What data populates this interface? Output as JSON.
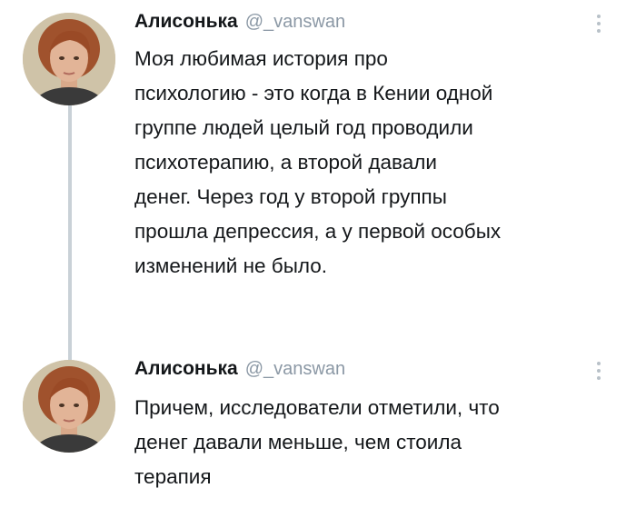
{
  "thread": {
    "line_color": "#c9d1d7",
    "tweets": [
      {
        "display_name": "Алисонька",
        "handle": "@_vanswan",
        "avatar_icon": "profile-photo-avatar",
        "more_icon": "vertical-ellipsis-icon",
        "text": "Моя любимая история про\nпсихологию - это когда в Кении одной\nгруппе людей целый год проводили\nпсихотерапию, а второй давали\nденег. Через год у второй группы\nпрошла депрессия, а у первой особых\nизменений не было."
      },
      {
        "display_name": "Алисонька",
        "handle": "@_vanswan",
        "avatar_icon": "profile-photo-avatar",
        "more_icon": "vertical-ellipsis-icon",
        "text": "Причем, исследователи отметили, что\nденег давали меньше, чем стоила\nтерапия"
      }
    ]
  }
}
